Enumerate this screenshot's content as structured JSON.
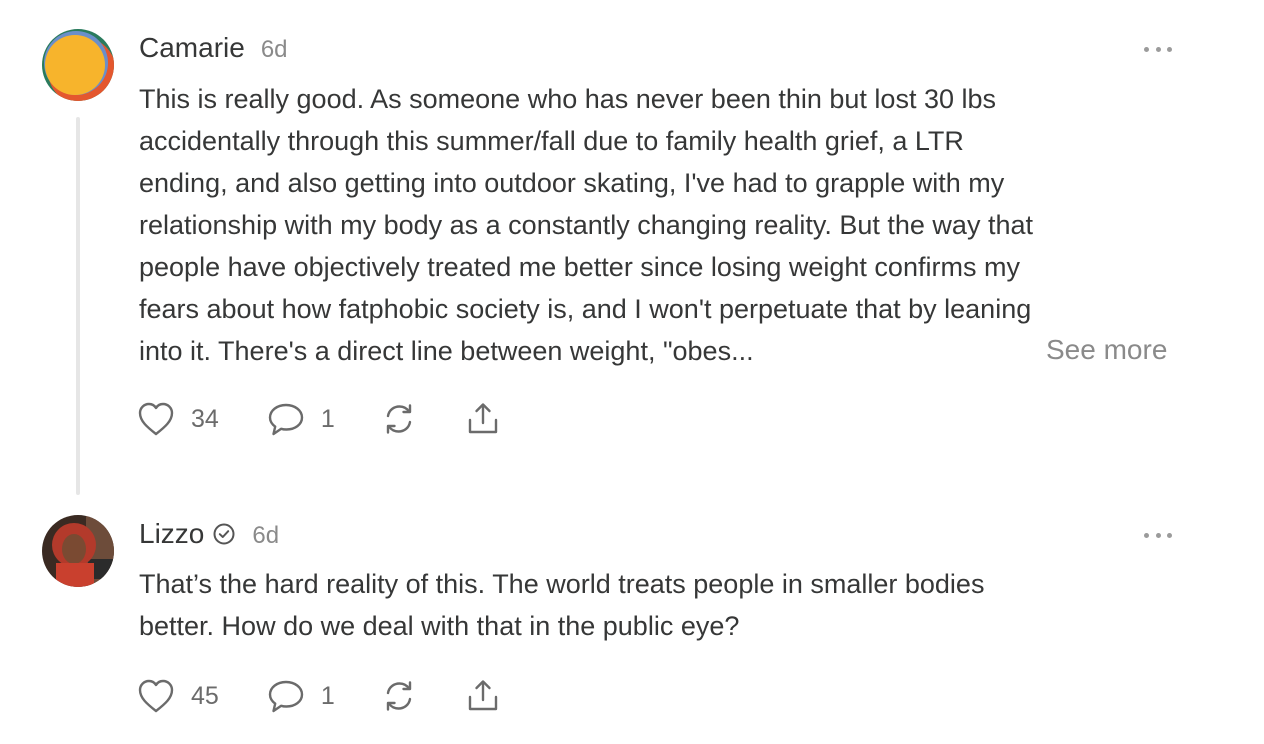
{
  "comments": [
    {
      "author": "Camarie",
      "time": "6d",
      "text_lines": [
        "This is really good. As someone who has never been thin but lost 30 lbs",
        "accidentally through this summer/fall due to family health grief, a LTR",
        "ending, and also getting into outdoor skating, I've had to grapple with my",
        "relationship with my body as a constantly changing reality. But the way that",
        "people have objectively treated me better since losing weight confirms my",
        "fears about how fatphobic society is, and I won't perpetuate that by leaning",
        "into it. There's a direct line between weight, \"obes..."
      ],
      "see_more": "See more",
      "likes": "34",
      "replies": "1"
    },
    {
      "author": "Lizzo",
      "time": "6d",
      "text_lines": [
        "That’s the hard reality of this. The world treats people in smaller bodies",
        "better. How do we deal with that in the public eye?"
      ],
      "likes": "45",
      "replies": "1"
    }
  ],
  "icons": {
    "like": "heart-icon",
    "reply": "speech-bubble-icon",
    "restack": "restack-icon",
    "share": "share-icon",
    "more": "ellipsis-icon",
    "verified": "verified-badge-icon"
  },
  "colors": {
    "text": "#363737",
    "muted": "#8a8a8a",
    "avatar_yellow": "#f7b42c",
    "avatar_green": "#2a7b5d",
    "avatar_orange": "#e4572e"
  }
}
